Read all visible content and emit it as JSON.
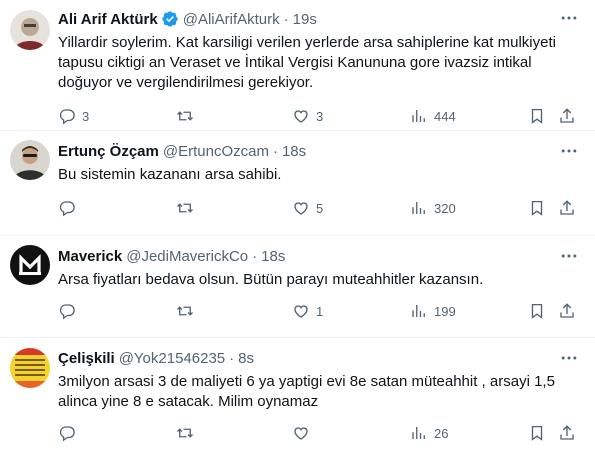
{
  "tweets": [
    {
      "name": "Ali Arif Aktürk",
      "verified": true,
      "handle": "@AliArifAkturk",
      "time": "19s",
      "text": "Yillardir soylerim. Kat karsiligi verilen yerlerde arsa sahiplerine kat mulkiyeti tapusu ciktigi an Veraset ve İntikal Vergisi Kanununa gore ivazsiz intikal doğuyor ve vergilendirilmesi gerekiyor.",
      "replies": "3",
      "retweets": "",
      "likes": "3",
      "views": "444"
    },
    {
      "name": "Ertunç Özçam",
      "verified": false,
      "handle": "@ErtuncOzcam",
      "time": "18s",
      "text": "Bu sistemin kazananı arsa sahibi.",
      "replies": "",
      "retweets": "",
      "likes": "5",
      "views": "320"
    },
    {
      "name": "Maverick",
      "verified": false,
      "handle": "@JediMaverickCo",
      "time": "18s",
      "text": "Arsa fiyatları bedava olsun. Bütün parayı muteahhitler kazansın.",
      "replies": "",
      "retweets": "",
      "likes": "1",
      "views": "199"
    },
    {
      "name": "Çelişkili",
      "verified": false,
      "handle": "@Yok21546235",
      "time": "8s",
      "text": "3milyon arsasi 3 de maliyeti 6 ya yaptigi evi 8e satan müteahhit , arsayi 1,5 alinca yine 8 e satacak. Milim oynamaz",
      "replies": "",
      "retweets": "",
      "likes": "",
      "views": "26"
    }
  ],
  "separator": "·",
  "colors": {
    "text": "#0f1419",
    "secondary": "#536471",
    "verified": "#1d9bf0",
    "border": "#eff3f4"
  },
  "icons": [
    "verified-badge-icon",
    "more-icon",
    "reply-icon",
    "retweet-icon",
    "like-icon",
    "views-icon",
    "bookmark-icon",
    "share-icon"
  ]
}
